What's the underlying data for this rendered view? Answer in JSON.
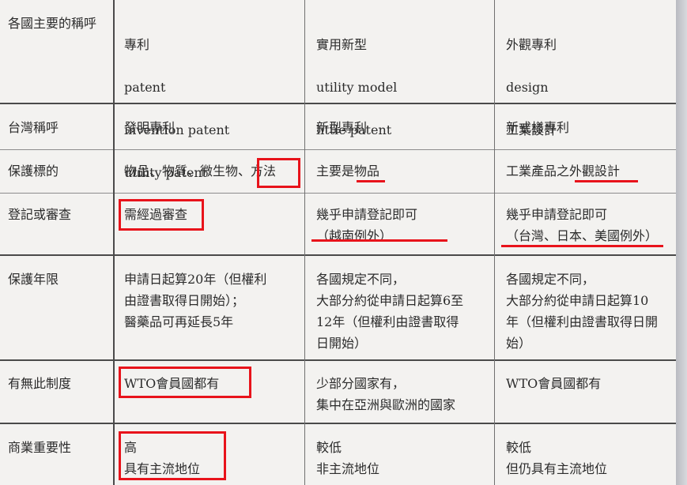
{
  "table": {
    "header": {
      "label": "各國主要的稱呼",
      "col1": [
        "專利",
        "patent",
        "invention patent",
        "utility patent"
      ],
      "col2": [
        "實用新型",
        "utility model",
        "little patent"
      ],
      "col3": [
        "外觀專利",
        "design",
        "工業設計"
      ]
    },
    "rows": [
      {
        "label": "台灣稱呼",
        "col1": "發明專利",
        "col2": "新型專利",
        "col3": "新式樣專利"
      },
      {
        "label": "保護標的",
        "col1": "物品、物質、微生物、方法",
        "col2": "主要是物品",
        "col3": "工業產品之外觀設計"
      },
      {
        "label": "登記或審查",
        "col1": "需經過審查",
        "col2": "幾乎申請登記即可\n（越南例外）",
        "col3": "幾乎申請登記即可\n（台灣、日本、美國例外）"
      },
      {
        "label": "保護年限",
        "col1": "申請日起算20年（但權利\n由證書取得日開始）；\n醫藥品可再延長5年",
        "col2": "各國規定不同，\n大部分約從申請日起算6至\n12年（但權利由證書取得\n日開始）",
        "col3": "各國規定不同，\n大部分約從申請日起算10\n年（但權利由證書取得日開\n始）"
      },
      {
        "label": "有無此制度",
        "col1": "WTO會員國都有",
        "col2": "少部分國家有，\n集中在亞洲與歐洲的國家",
        "col3": "WTO會員國都有"
      },
      {
        "label": "商業重要性",
        "col1": "高\n具有主流地位",
        "col2": "較低\n非主流地位",
        "col3": "較低\n但仍具有主流地位"
      }
    ]
  },
  "highlight_color": "#e8131b"
}
